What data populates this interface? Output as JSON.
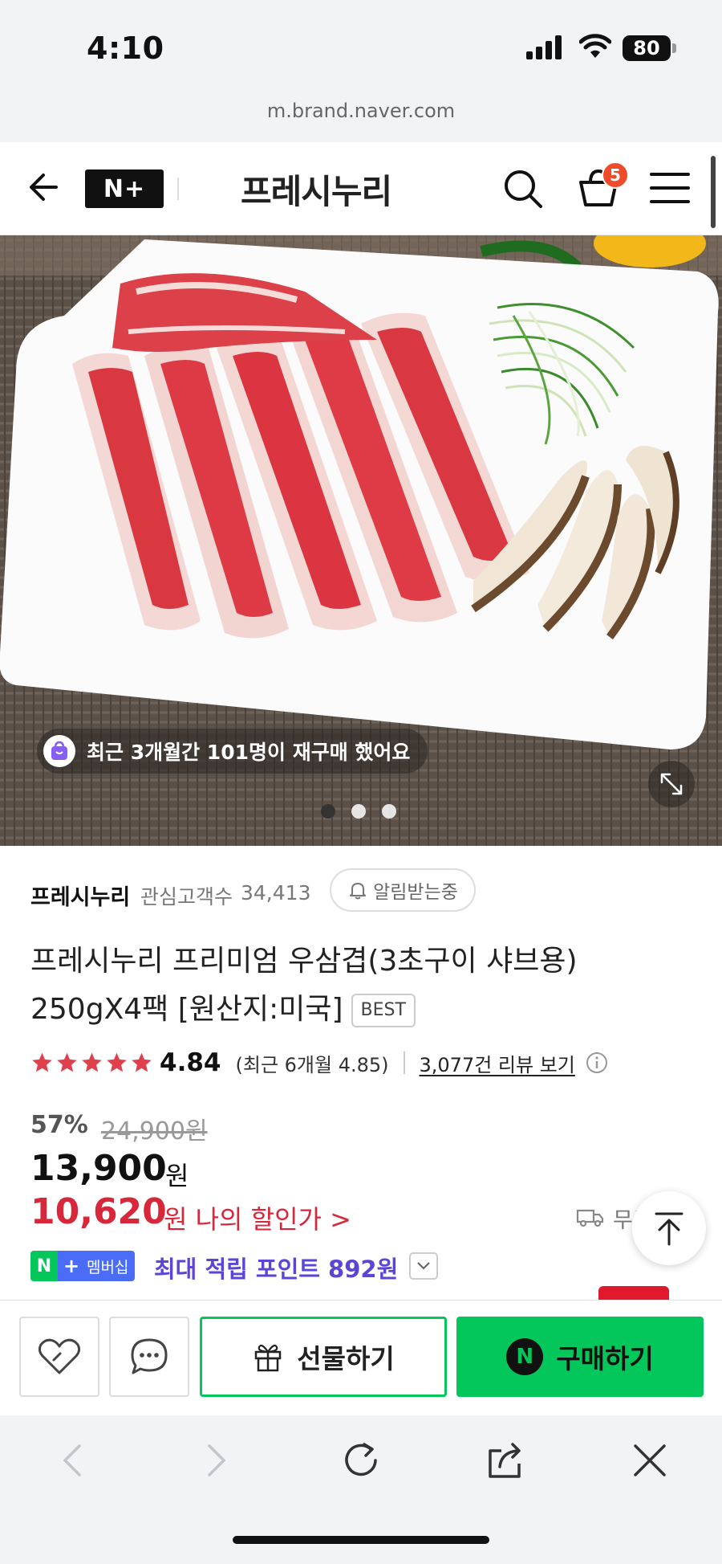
{
  "status_bar": {
    "time": "4:10",
    "battery": "80"
  },
  "browser": {
    "url": "m.brand.naver.com"
  },
  "header": {
    "naver_logo": "N+",
    "store_logo": "프레시누리",
    "cart_count": "5"
  },
  "hero": {
    "repurchase_text": "최근 3개월간 101명이 재구매 했어요",
    "slide_count": 3,
    "active_slide": 1
  },
  "product": {
    "store_name": "프레시누리",
    "follower_label": "관심고객수",
    "follower_count": "34,413",
    "notify_label": "알림받는중",
    "title": "프레시누리 프리미엄 우삼겹(3초구이 샤브용) 250gX4팩 [원산지:미국]",
    "best_badge": "BEST",
    "rating": "4.84",
    "rating_recent": "(최근 6개월 4.85)",
    "review_link": "3,077건 리뷰 보기",
    "discount_rate": "57%",
    "original_price": "24,900원",
    "sale_price": "13,900",
    "sale_price_unit": "원",
    "my_price": "10,620",
    "my_price_label": "원 나의 할인가 >",
    "delivery_text": "무료",
    "membership_badge": {
      "n": "N",
      "plus": "+",
      "label": "멤버십"
    },
    "points_text": "최대 적립 포인트 892원"
  },
  "actions": {
    "gift_label": "선물하기",
    "buy_label": "구매하기",
    "buy_icon": "N"
  },
  "colors": {
    "naver_green": "#03c75a",
    "price_red": "#d8263a",
    "points_purple": "#5a45d6",
    "badge_orange": "#f04b2b"
  }
}
